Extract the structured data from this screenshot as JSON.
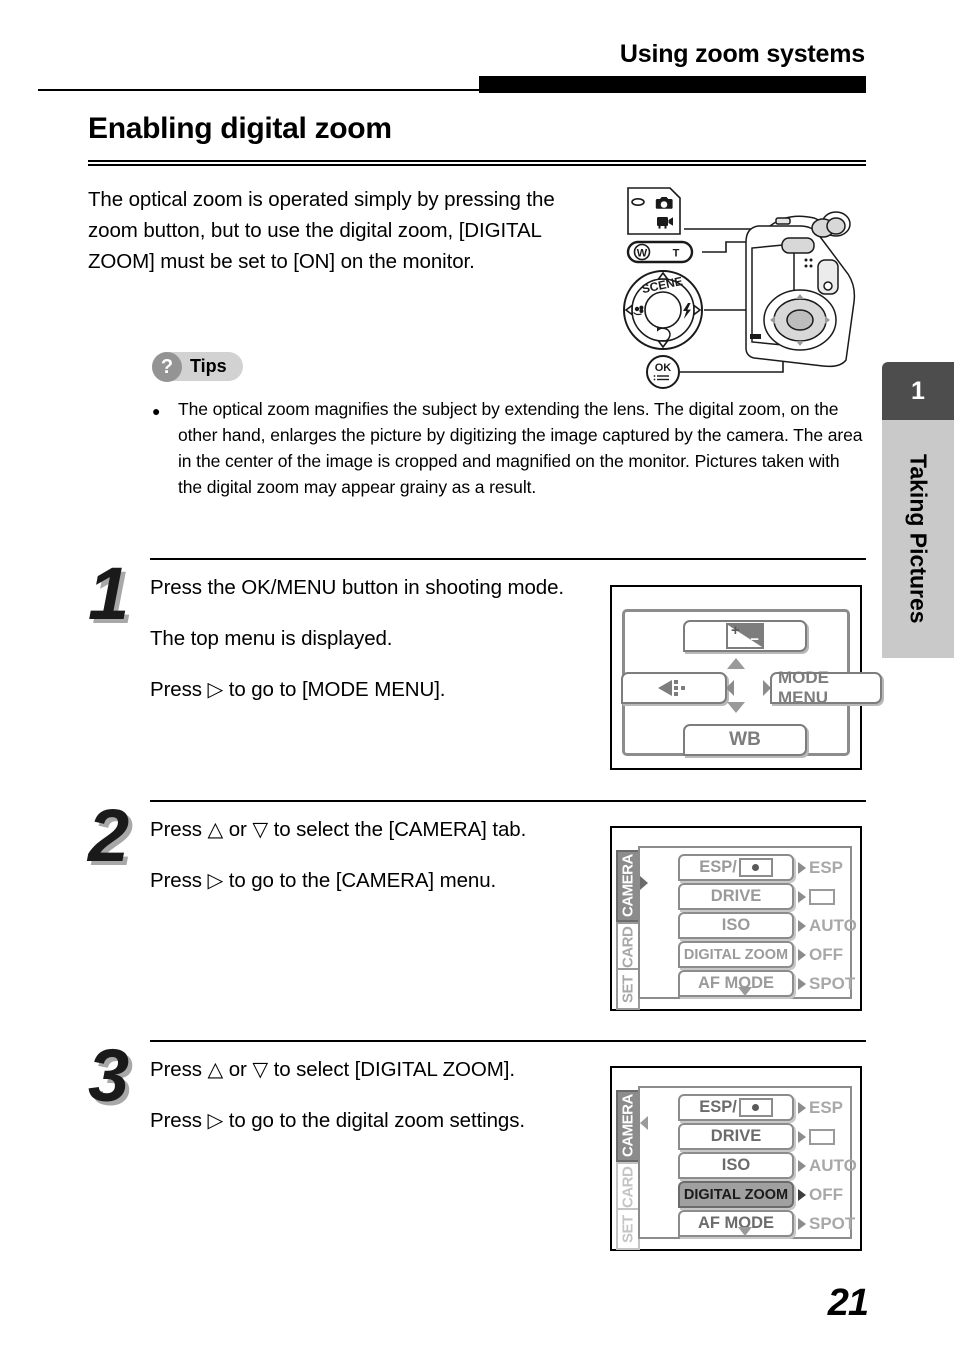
{
  "header": {
    "running_head": "Using zoom systems"
  },
  "section": {
    "title": "Enabling digital zoom",
    "intro": "The optical zoom is operated simply by pressing the zoom button, but to use the digital zoom, [DIGITAL ZOOM] must be set to [ON] on the monitor."
  },
  "tips": {
    "badge_label": "Tips",
    "badge_icon": "question-mark-icon",
    "body": "The optical zoom magnifies the subject by extending the lens. The digital zoom, on the other hand, enlarges the picture by digitizing the image captured by the camera. The area in the center of the image is cropped and magnified on the monitor. Pictures taken with the digital zoom may appear grainy as a result."
  },
  "camera_illustration": {
    "mode_still_icon": "camera-still-icon",
    "mode_movie_icon": "camera-movie-icon",
    "zoom_wide_label": "W",
    "zoom_tele_label": "T",
    "pad_scene_label": "SCENE",
    "pad_macro_icon": "macro-flower-icon",
    "pad_flash_icon": "flash-bolt-icon",
    "pad_timer_icon": "self-timer-icon",
    "ok_label": "OK",
    "ok_menu_icon": "menu-list-icon"
  },
  "steps": [
    {
      "number": "1",
      "paragraphs": [
        "Press the OK/MENU button in shooting mode.",
        "The top menu is displayed.",
        "Press ▷ to go to [MODE MENU]."
      ],
      "screen": {
        "type": "top-menu",
        "top_item_icon": "exposure-compensation-icon",
        "exposure_plus": "+",
        "exposure_minus": "−",
        "left_item_icon": "drive-playback-icon",
        "right_item_label": "MODE MENU",
        "bottom_item_label": "WB"
      }
    },
    {
      "number": "2",
      "paragraphs": [
        "Press △ or ▽ to select the [CAMERA] tab.",
        "Press ▷ to go to the [CAMERA] menu."
      ],
      "screen": {
        "type": "mode-menu",
        "tabs": [
          {
            "label": "CAMERA",
            "state": "selected"
          },
          {
            "label": "CARD",
            "state": "normal"
          },
          {
            "label": "SET",
            "state": "normal"
          }
        ],
        "rows": [
          {
            "label": "ESP/",
            "label_icon": "spot-metering-icon",
            "value": "ESP",
            "selected": false
          },
          {
            "label": "DRIVE",
            "value_icon": "single-frame-icon",
            "value": "",
            "selected": false
          },
          {
            "label": "ISO",
            "value": "AUTO",
            "selected": false
          },
          {
            "label": "DIGITAL ZOOM",
            "value": "OFF",
            "selected": false
          },
          {
            "label": "AF MODE",
            "value": "SPOT",
            "selected": false
          }
        ]
      }
    },
    {
      "number": "3",
      "paragraphs": [
        "Press △ or ▽ to select [DIGITAL ZOOM].",
        "Press ▷ to go to the digital zoom settings."
      ],
      "screen": {
        "type": "mode-menu",
        "tabs": [
          {
            "label": "CAMERA",
            "state": "selected"
          },
          {
            "label": "CARD",
            "state": "faint"
          },
          {
            "label": "SET",
            "state": "faint"
          }
        ],
        "rows": [
          {
            "label": "ESP/",
            "label_icon": "spot-metering-icon",
            "value": "ESP",
            "selected": false
          },
          {
            "label": "DRIVE",
            "value_icon": "single-frame-icon",
            "value": "",
            "selected": false
          },
          {
            "label": "ISO",
            "value": "AUTO",
            "selected": false
          },
          {
            "label": "DIGITAL ZOOM",
            "value": "OFF",
            "selected": true
          },
          {
            "label": "AF MODE",
            "value": "SPOT",
            "selected": false
          }
        ]
      }
    }
  ],
  "chapter": {
    "number": "1",
    "title": "Taking Pictures"
  },
  "page_number": "21",
  "colors": {
    "rule": "#000000",
    "chapter_tab": "#4d4d4d",
    "chapter_band": "#c9c9c9",
    "tips_pill": "#d2d2d2",
    "tips_circle": "#949494",
    "menu_gray": "#8c8c8c",
    "menu_selected": "#a0a0a0"
  }
}
